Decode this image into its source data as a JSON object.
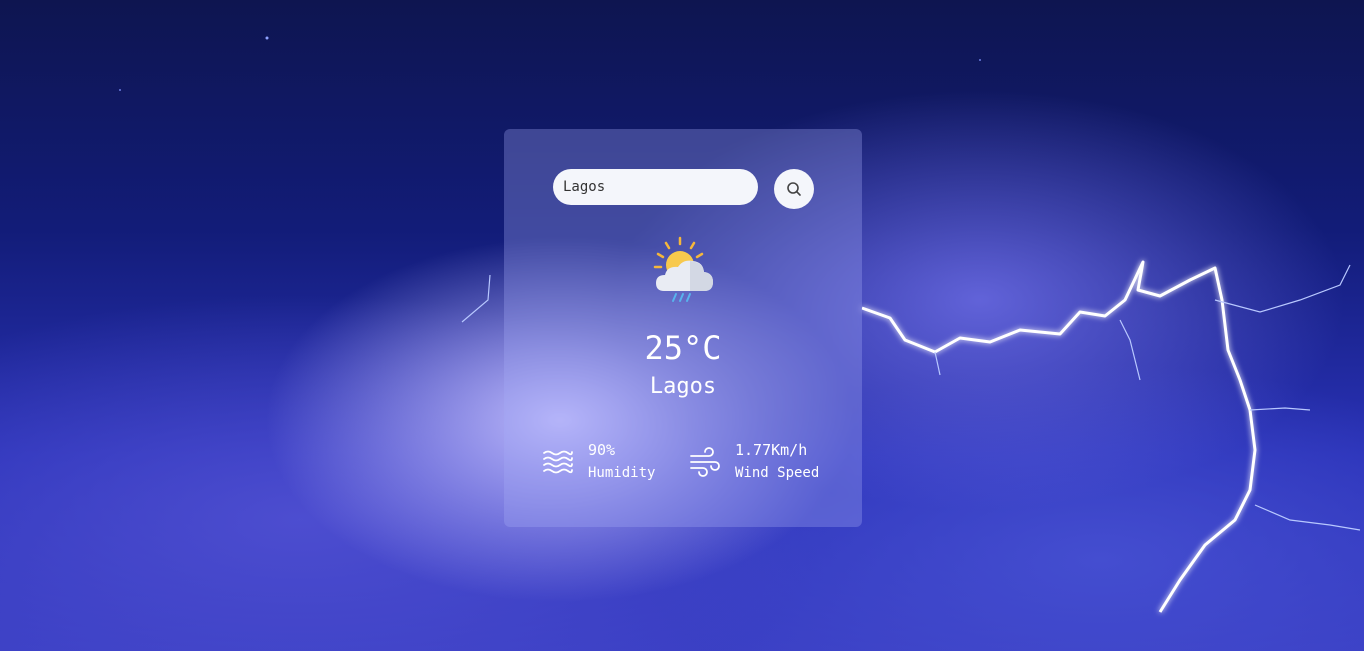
{
  "search": {
    "value": "Lagos",
    "button_icon": "search-icon"
  },
  "weather": {
    "icon": "sun-cloud-rain-icon",
    "temperature": "25°C",
    "city": "Lagos"
  },
  "details": {
    "humidity": {
      "icon": "waves-icon",
      "value": "90%",
      "label": "Humidity"
    },
    "wind": {
      "icon": "wind-icon",
      "value": "1.77Km/h",
      "label": "Wind Speed"
    }
  },
  "colors": {
    "card_background": "#a5aaf5",
    "input_background": "#f4f6fb",
    "text": "#ffffff",
    "sky_dark": "#0e1550",
    "sky_mid": "#2a32b8",
    "lightning": "#ffffff"
  }
}
